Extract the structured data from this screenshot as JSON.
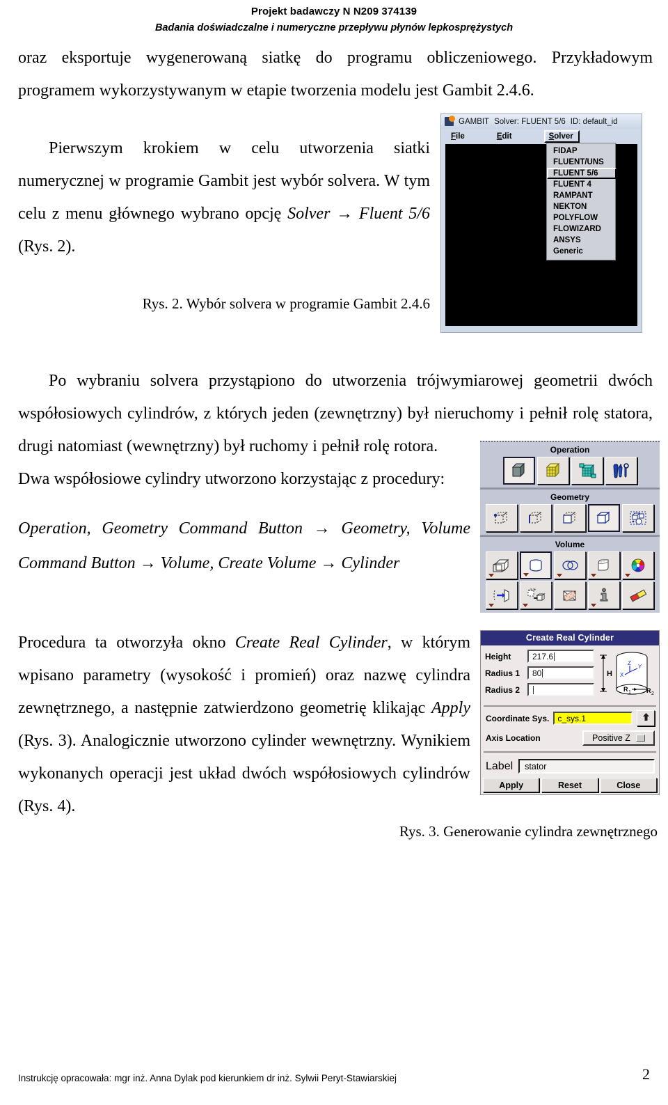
{
  "header": {
    "project_line": "Projekt badawczy N N209 374139",
    "subtitle_line": "Badania doświadczalne i numeryczne przepływu płynów lepkosprężystych"
  },
  "body": {
    "p1": "oraz eksportuje wygenerowaną siatkę do programu obliczeniowego. Przykładowym programem wykorzystywanym w etapie tworzenia modelu jest Gambit 2.4.6.",
    "p2_a": "Pierwszym krokiem w celu utworzenia siatki numerycznej w programie Gambit jest wybór solvera. W tym celu z menu głównego wybrano opcję ",
    "p2_em": "Solver → Fluent 5/6",
    "p2_b": " (Rys. 2).",
    "caption_fig2": "Rys. 2. Wybór solvera w programie Gambit 2.4.6",
    "p3": "Po wybraniu solvera przystąpiono do utworzenia trójwymiarowej geometrii dwóch współosiowych cylindrów, z których jeden (zewnętrzny) był nieruchomy i pełnił rolę statora, drugi natomiast (wewnętrzny) był ruchomy i pełnił rolę rotora.",
    "p4": "Dwa współosiowe cylindry utworzono korzystając z procedury:",
    "p5": "Operation, Geometry Command Button → Geometry, Volume Command Button → Volume, Create Volume → Cylinder",
    "p6_a": "Procedura ta otworzyła okno ",
    "p6_em1": "Create Real Cylinder",
    "p6_b": ", w którym wpisano parametry (wysokość i promień) oraz nazwę cylindra zewnętrznego, a następnie zatwierdzono geometrię klikając ",
    "p6_em2": "Apply",
    "p6_c": " (Rys. 3). Analogicznie utworzono cylinder wewnętrzny. Wynikiem wykonanych operacji jest układ dwóch współosiowych cylindrów (Rys. 4).",
    "caption_fig3": "Rys. 3. Generowanie cylindra zewnętrznego"
  },
  "footer": {
    "credit": "Instrukcję opracowała: mgr inż. Anna Dylak pod kierunkiem dr inż. Sylwii Peryt-Stawiarskiej",
    "page_number": "2"
  },
  "gambit_window": {
    "app_name": "GAMBIT",
    "solver_status": "Solver: FLUENT 5/6",
    "id_status": "ID: default_id",
    "menus": [
      {
        "label": "File",
        "mnemonic": "F"
      },
      {
        "label": "Edit",
        "mnemonic": "E"
      },
      {
        "label": "Solver",
        "mnemonic": "S"
      }
    ],
    "solver_menu_options": [
      "FIDAP",
      "FLUENT/UNS",
      "FLUENT 5/6",
      "FLUENT 4",
      "RAMPANT",
      "NEKTON",
      "POLYFLOW",
      "FLOWIZARD",
      "ANSYS",
      "Generic"
    ],
    "selected_option": "FLUENT 5/6",
    "canvas_color": "#000000"
  },
  "tool_panel": {
    "sections": [
      {
        "title": "Operation"
      },
      {
        "title": "Geometry"
      },
      {
        "title": "Volume"
      }
    ],
    "operation_buttons": [
      "geometry-operation-icon",
      "mesh-operation-icon",
      "zones-operation-icon",
      "tools-operation-icon"
    ],
    "geometry_buttons": [
      "vertex-geometry-icon",
      "edge-geometry-icon",
      "face-geometry-icon",
      "volume-geometry-icon",
      "group-geometry-icon"
    ],
    "volume_buttons_row1": [
      "create-volume-icon",
      "create-cylinder-icon",
      "boolean-volume-icon",
      "split-volume-icon",
      "color-volume-icon"
    ],
    "volume_buttons_row2": [
      "move-copy-volume-icon",
      "connect-volume-icon",
      "blend-volume-icon",
      "summarize-volume-icon",
      "delete-volume-icon"
    ]
  },
  "create_real_cylinder": {
    "title": "Create Real Cylinder",
    "fields": [
      {
        "label": "Height",
        "value": "217.6"
      },
      {
        "label": "Radius 1",
        "value": "80"
      },
      {
        "label": "Radius 2",
        "value": ""
      }
    ],
    "diagram": {
      "height_symbol": "H",
      "radius1_symbol": "R",
      "radius1_sub": "1",
      "radius2_symbol": "R",
      "radius2_sub": "2",
      "axis_z": "Z",
      "axis_y": "Y",
      "axis_x": "X"
    },
    "coordinate_sys_label": "Coordinate Sys.",
    "coordinate_sys_value": "c_sys.1",
    "coordinate_sys_color": "#ffff00",
    "axis_location_label": "Axis Location",
    "axis_location_value": "Positive Z",
    "label_label": "Label",
    "label_value": "stator",
    "buttons": [
      "Apply",
      "Reset",
      "Close"
    ],
    "titlebar_color": "#2e2e7a"
  }
}
